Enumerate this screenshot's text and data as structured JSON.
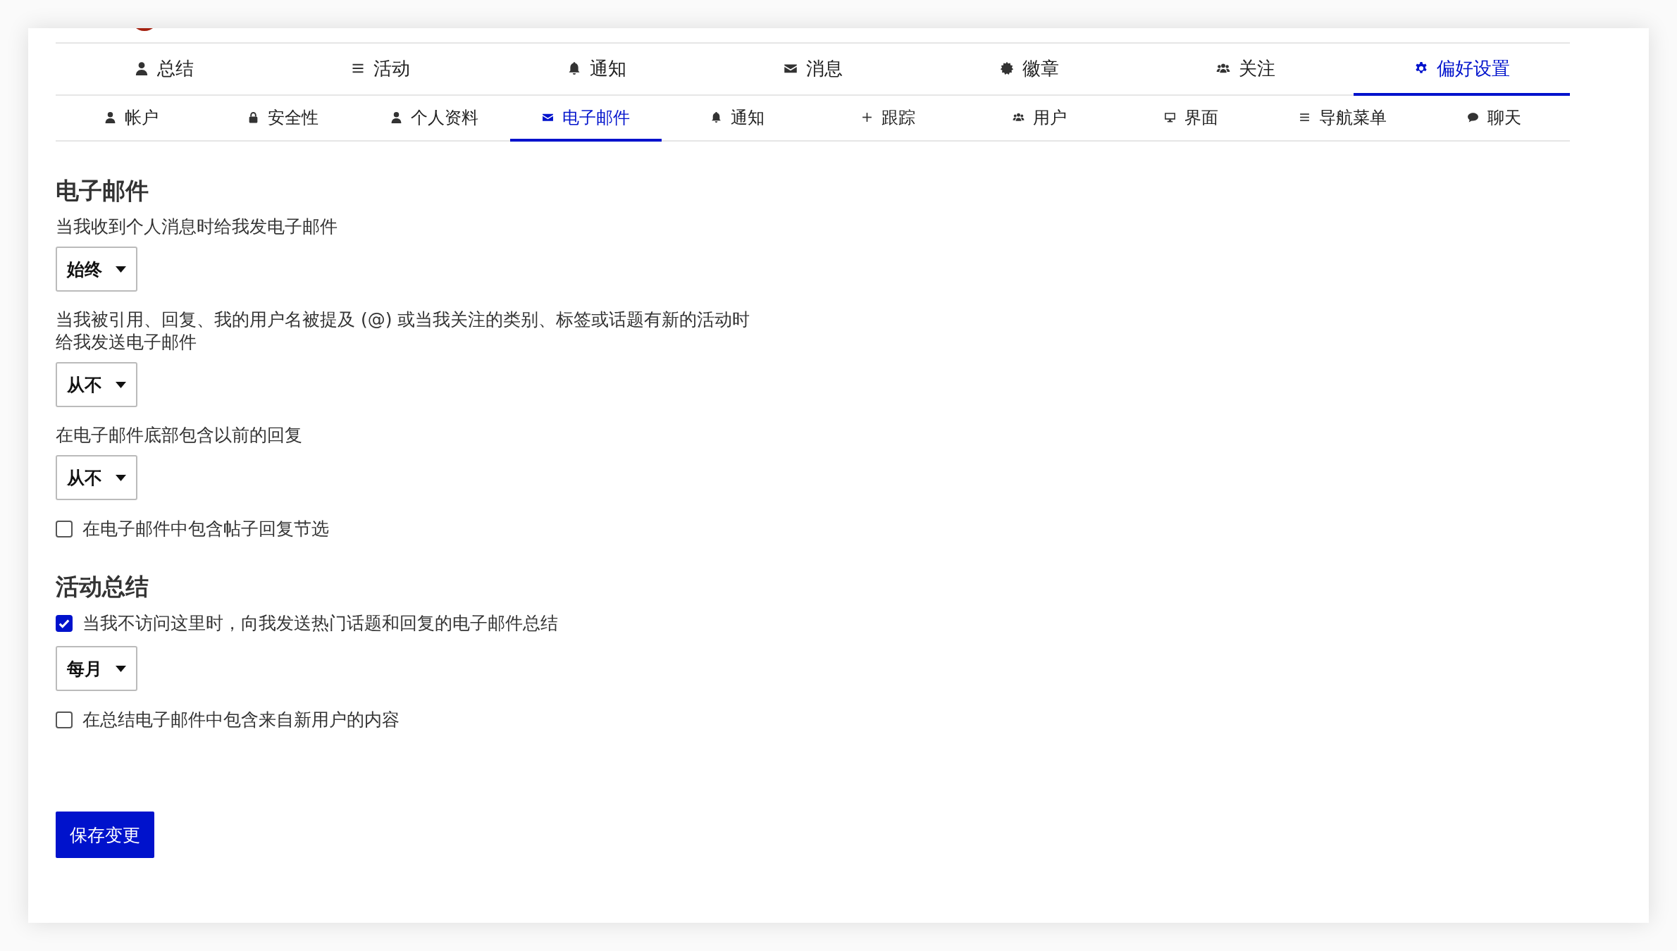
{
  "nav": {
    "tabs": [
      {
        "kind": "user",
        "label": "总结",
        "selected": false
      },
      {
        "kind": "list",
        "label": "活动",
        "selected": false
      },
      {
        "kind": "bell",
        "label": "通知",
        "selected": false
      },
      {
        "kind": "envelope",
        "label": "消息",
        "selected": false
      },
      {
        "kind": "badge",
        "label": "徽章",
        "selected": false
      },
      {
        "kind": "users",
        "label": "关注",
        "selected": false
      },
      {
        "kind": "gear",
        "label": "偏好设置",
        "selected": true
      }
    ]
  },
  "subnav": {
    "tabs": [
      {
        "kind": "user",
        "label": "帐户",
        "selected": false
      },
      {
        "kind": "lock",
        "label": "安全性",
        "selected": false
      },
      {
        "kind": "user",
        "label": "个人资料",
        "selected": false
      },
      {
        "kind": "envelope",
        "label": "电子邮件",
        "selected": true
      },
      {
        "kind": "bell",
        "label": "通知",
        "selected": false
      },
      {
        "kind": "plus",
        "label": "跟踪",
        "selected": false
      },
      {
        "kind": "users",
        "label": "用户",
        "selected": false
      },
      {
        "kind": "monitor",
        "label": "界面",
        "selected": false
      },
      {
        "kind": "list",
        "label": "导航菜单",
        "selected": false
      },
      {
        "kind": "comment",
        "label": "聊天",
        "selected": false
      }
    ]
  },
  "sections": [
    {
      "title": "电子邮件",
      "fields": [
        {
          "kind": "select",
          "label": "当我收到个人消息时给我发电子邮件",
          "value": "始终"
        },
        {
          "kind": "select",
          "label": "当我被引用、回复、我的用户名被提及 (@) 或当我关注的类别、标签或话题有新的活动时给我发送电子邮件",
          "value": "从不"
        },
        {
          "kind": "select",
          "label": "在电子邮件底部包含以前的回复",
          "value": "从不"
        },
        {
          "kind": "checkbox",
          "label": "在电子邮件中包含帖子回复节选",
          "checked": false
        }
      ]
    },
    {
      "title": "活动总结",
      "fields": [
        {
          "kind": "checkbox",
          "label": "当我不访问这里时，向我发送热门话题和回复的电子邮件总结",
          "checked": true
        },
        {
          "kind": "select",
          "value": "每月"
        },
        {
          "kind": "checkbox",
          "label": "在总结电子邮件中包含来自新用户的内容",
          "checked": false
        }
      ]
    }
  ],
  "save_button": "保存变更"
}
